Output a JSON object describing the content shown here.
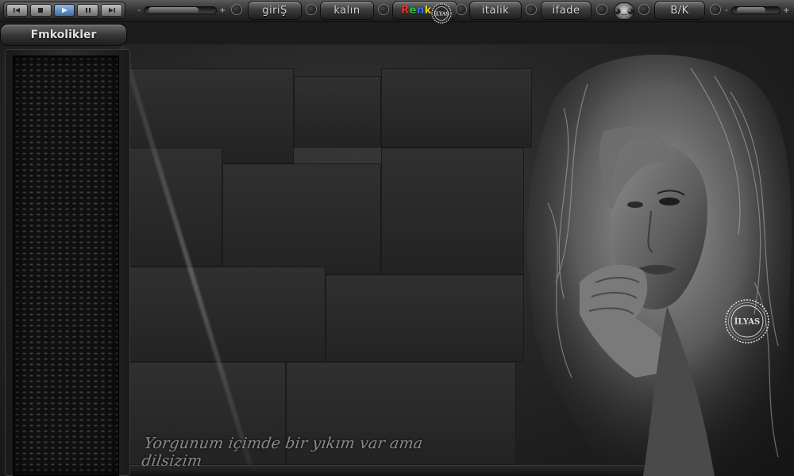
{
  "toolbar": {
    "transport": [
      "rewind",
      "stop",
      "play",
      "pause",
      "forward"
    ],
    "volume_minus": "-",
    "volume_plus": "+",
    "volume_level": 0.7,
    "buttons": {
      "giris": "giriŞ",
      "kalin": "kalın",
      "renk": [
        "R",
        "e",
        "n",
        "k"
      ],
      "italik": "italik",
      "ifade": "ifade",
      "bk": "B/K"
    },
    "renk_colors": [
      "#e03030",
      "#30c040",
      "#3070e0",
      "#e0d020"
    ],
    "emoji_icon": "smiley-icon",
    "seal_text": "İLYAS"
  },
  "room": {
    "name": "Fmkolikler"
  },
  "chat_area": {
    "caption": "Yorgunum içimde bir yıkım var ama dilsizim",
    "watermark": "İLYAS"
  }
}
